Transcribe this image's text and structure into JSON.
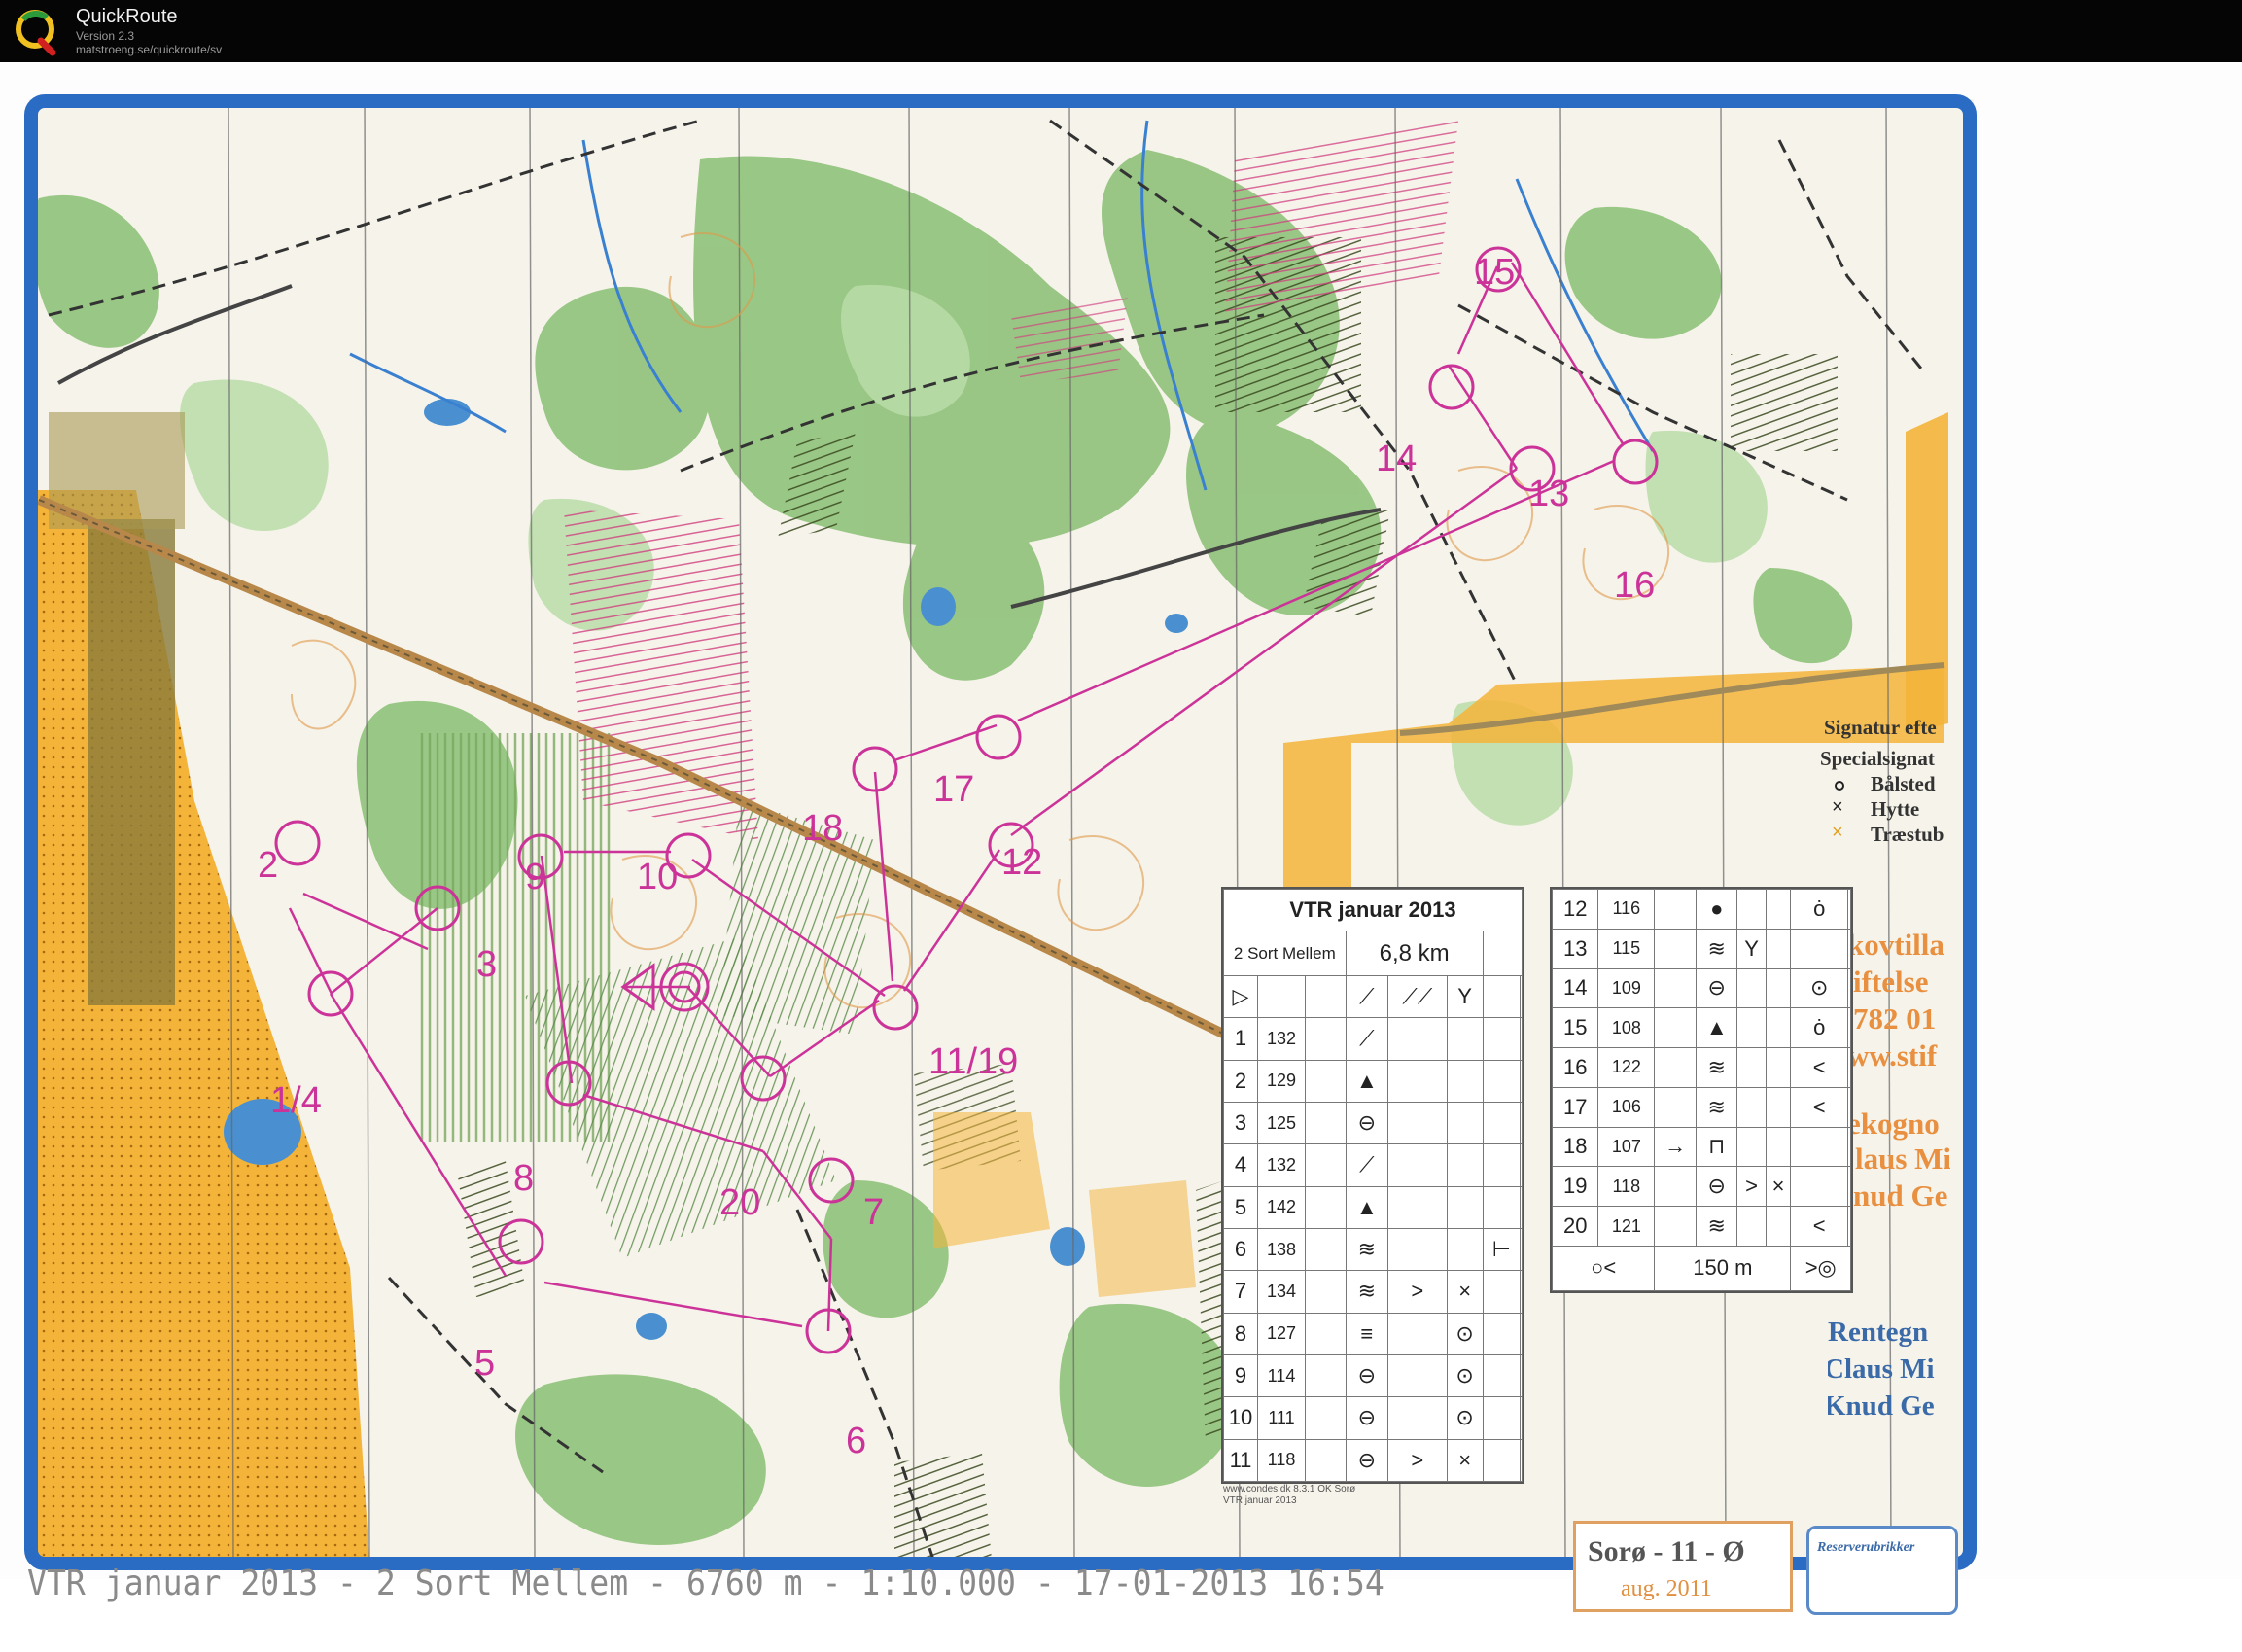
{
  "app": {
    "name": "QuickRoute",
    "version": "Version 2.3",
    "url": "matstroeng.se/quickroute/sv"
  },
  "caption": "VTR januar 2013 - 2 Sort Mellem - 6760 m - 1:10.000 - 17-01-2013 16:54",
  "colors": {
    "frame": "#2a6cc4",
    "course": "#cc3399",
    "forest": "#8fc27a",
    "open": "#f3b234",
    "water": "#4a90d0"
  },
  "controls": [
    {
      "label": "2"
    },
    {
      "label": "3"
    },
    {
      "label": "1/4"
    },
    {
      "label": "5"
    },
    {
      "label": "6"
    },
    {
      "label": "7"
    },
    {
      "label": "20"
    },
    {
      "label": "8"
    },
    {
      "label": "9"
    },
    {
      "label": "10"
    },
    {
      "label": "11/19"
    },
    {
      "label": "12"
    },
    {
      "label": "17"
    },
    {
      "label": "18"
    },
    {
      "label": "13"
    },
    {
      "label": "14"
    },
    {
      "label": "15"
    },
    {
      "label": "16"
    }
  ],
  "description_left": {
    "title": "VTR januar 2013",
    "course": "2 Sort Mellem",
    "length": "6,8 km",
    "rows": [
      {
        "n": "1",
        "code": "132"
      },
      {
        "n": "2",
        "code": "129"
      },
      {
        "n": "3",
        "code": "125"
      },
      {
        "n": "4",
        "code": "132"
      },
      {
        "n": "5",
        "code": "142"
      },
      {
        "n": "6",
        "code": "138"
      },
      {
        "n": "7",
        "code": "134"
      },
      {
        "n": "8",
        "code": "127"
      },
      {
        "n": "9",
        "code": "114"
      },
      {
        "n": "10",
        "code": "111"
      },
      {
        "n": "11",
        "code": "118"
      }
    ],
    "footnote1": "www.condes.dk 8.3.1 OK Sorø",
    "footnote2": "VTR januar 2013"
  },
  "description_right": {
    "rows": [
      {
        "n": "12",
        "code": "116"
      },
      {
        "n": "13",
        "code": "115"
      },
      {
        "n": "14",
        "code": "109"
      },
      {
        "n": "15",
        "code": "108"
      },
      {
        "n": "16",
        "code": "122"
      },
      {
        "n": "17",
        "code": "106"
      },
      {
        "n": "18",
        "code": "107"
      },
      {
        "n": "19",
        "code": "118"
      },
      {
        "n": "20",
        "code": "121"
      }
    ],
    "finish_distance": "150 m"
  },
  "legend": {
    "title": "Signatur efte",
    "subtitle": "Specialsignat",
    "items": [
      "Bålsted",
      "Hytte",
      "Træstub"
    ]
  },
  "side_text": {
    "orange": [
      "kovtilla",
      "iftelse",
      "782 01",
      "ww.stif",
      "ekogno",
      "laus Mi",
      "nud Ge"
    ],
    "blue": [
      "Rentegn",
      "Claus Mi",
      "Knud Ge"
    ]
  },
  "club": {
    "name": "Sorø - 11 - Ø",
    "date": "aug. 2011"
  },
  "reserve": "Reserverubrikker"
}
